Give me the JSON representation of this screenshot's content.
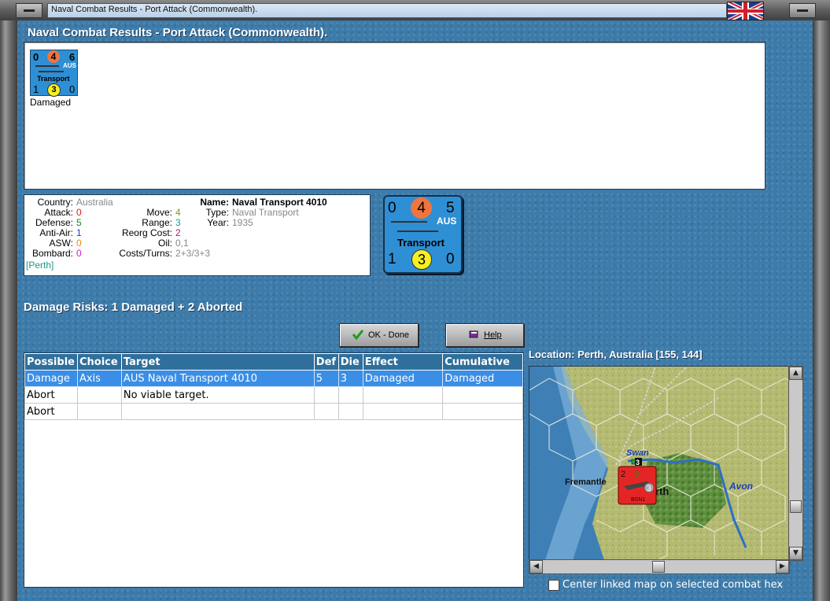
{
  "window": {
    "title": "Naval Combat Results - Port Attack (Commonwealth).",
    "flag": "uk-flag-icon"
  },
  "heading": "Naval Combat Results - Port Attack (Commonwealth).",
  "result_unit": {
    "attack": "0",
    "defense_top": "4",
    "move": "6",
    "nation": "AUS",
    "type_label": "Transport",
    "anti_air": "1",
    "center": "3",
    "asw": "0",
    "status": "Damaged"
  },
  "unit_stats": {
    "country_label": "Country:",
    "country": "Australia",
    "attack_label": "Attack:",
    "attack": "0",
    "defense_label": "Defense:",
    "defense": "5",
    "antiair_label": "Anti-Air:",
    "antiair": "1",
    "asw_label": "ASW:",
    "asw": "0",
    "bombard_label": "Bombard:",
    "bombard": "0",
    "location": "[Perth]",
    "move_label": "Move:",
    "move": "4",
    "range_label": "Range:",
    "range": "3",
    "reorg_label": "Reorg Cost:",
    "reorg": "2",
    "oil_label": "Oil:",
    "oil": "0,1",
    "costs_label": "Costs/Turns:",
    "costs": "2+3/3+3",
    "name_label": "Name:",
    "name": "Naval Transport 4010",
    "type_label": "Type:",
    "type": "Naval Transport",
    "year_label": "Year:",
    "year": "1935"
  },
  "big_unit": {
    "tl": "0",
    "circle_top": "4",
    "tr": "5",
    "nation": "AUS",
    "type_label": "Transport",
    "bl": "1",
    "circle_bottom": "3",
    "br": "0"
  },
  "damage_risks": "Damage Risks:  1 Damaged + 2 Aborted",
  "buttons": {
    "ok": "OK - Done",
    "help": "Help"
  },
  "table": {
    "headers": [
      "Possible",
      "Choice",
      "Target",
      "Def",
      "Die",
      "Effect",
      "Cumulative"
    ],
    "rows": [
      [
        "Damage",
        "Axis",
        "AUS Naval Transport 4010",
        "5",
        "3",
        "Damaged",
        "Damaged"
      ],
      [
        "Abort",
        "",
        "No viable target.",
        "",
        "",
        "",
        ""
      ],
      [
        "Abort",
        "",
        "",
        "",
        "",
        "",
        ""
      ]
    ]
  },
  "location": "Location:  Perth, Australia [155, 144]",
  "map": {
    "labels": {
      "swan": "Swan",
      "fremantle": "Fremantle",
      "perth": "rth",
      "avon": "Avon"
    },
    "unit": {
      "tl": "2",
      "tr": "3",
      "circle": "3",
      "code": "BSN1",
      "stack_count": "3"
    }
  },
  "center_checkbox": {
    "label": "Center linked map on selected combat hex",
    "checked": false
  }
}
